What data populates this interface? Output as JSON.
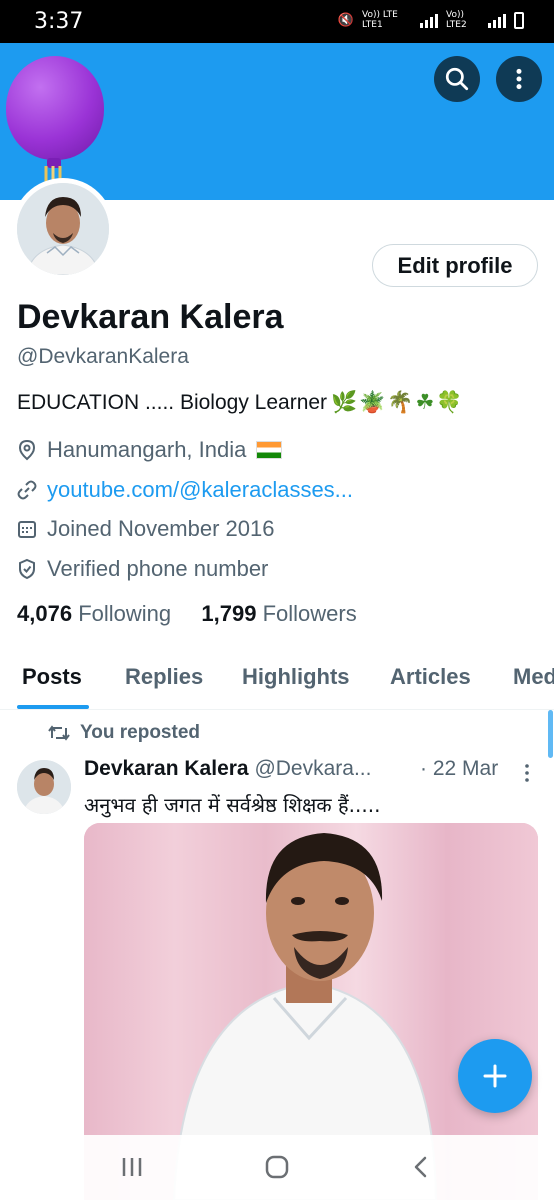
{
  "status_bar": {
    "time": "3:37",
    "network_1": "Vo)) LTE LTE1",
    "network_2": "Vo)) LTE2"
  },
  "profile": {
    "name": "Devkaran Kalera",
    "handle": "@DevkaranKalera",
    "bio": "EDUCATION ..... Biology Learner",
    "bio_emojis": "🌿🪴🌴☘🍀",
    "location": "Hanumangarh, India",
    "website": "youtube.com/@kaleraclasses...",
    "joined": "Joined November 2016",
    "verified": "Verified phone number",
    "following_count": "4,076",
    "following_label": "Following",
    "followers_count": "1,799",
    "followers_label": "Followers",
    "edit_label": "Edit profile"
  },
  "tabs": [
    {
      "label": "Posts"
    },
    {
      "label": "Replies"
    },
    {
      "label": "Highlights"
    },
    {
      "label": "Articles"
    },
    {
      "label": "Media"
    }
  ],
  "post": {
    "repost_label": "You reposted",
    "author_name": "Devkaran Kalera",
    "author_handle": "@Devkara...",
    "date": "· 22 Mar",
    "text": "अनुभव ही जगत में सर्वश्रेष्ठ शिक्षक हैं....."
  },
  "colors": {
    "accent": "#1d9bf0",
    "banner": "#1d9bf0",
    "text_primary": "#0f1419",
    "text_secondary": "#536471"
  },
  "icons": {
    "search": "search-icon",
    "more": "more-vertical-icon",
    "location": "location-pin-icon",
    "link": "link-icon",
    "calendar": "calendar-icon",
    "verified": "shield-check-icon",
    "repost": "repost-icon",
    "compose": "plus-icon"
  }
}
